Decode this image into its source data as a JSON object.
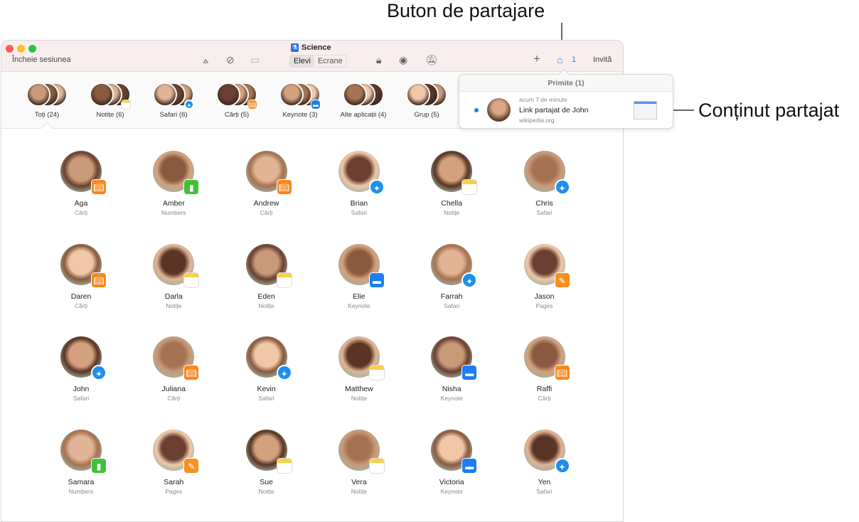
{
  "callouts": {
    "share_button": "Buton de partajare",
    "shared_content": "Conținut partajat"
  },
  "window": {
    "title": "Science",
    "end_session": "Încheie sesiunea",
    "segments": [
      "Elevi",
      "Ecrane"
    ],
    "selected_segment": "Elevi",
    "inbox_count": "1",
    "invite": "Invită",
    "toolbar_icons": [
      "app-store-icon",
      "safari-compass-icon",
      "airplay-icon",
      "lock-icon",
      "hide-eye-icon",
      "mute-bell-icon",
      "plus-icon",
      "inbox-tray-icon"
    ]
  },
  "groups": [
    {
      "label": "Toți (24)"
    },
    {
      "label": "Notițe (6)",
      "app": "notes"
    },
    {
      "label": "Safari (6)",
      "app": "safari"
    },
    {
      "label": "Cărți (5)",
      "app": "books"
    },
    {
      "label": "Keynote (3)",
      "app": "keynote"
    },
    {
      "label": "Alte aplicații (4)"
    },
    {
      "label": "Grup (5)"
    }
  ],
  "selected_group": "Toți (24)",
  "inbox": {
    "header": "Primite (1)",
    "item": {
      "time": "acum 7 de minute",
      "title": "Link partajat de John",
      "source": "wikipedia.org",
      "unread": true
    }
  },
  "students": [
    {
      "name": "Aga",
      "app": "Cărți",
      "badge": "books"
    },
    {
      "name": "Amber",
      "app": "Numbers",
      "badge": "numbers"
    },
    {
      "name": "Andrew",
      "app": "Cărți",
      "badge": "books"
    },
    {
      "name": "Brian",
      "app": "Safari",
      "badge": "safari"
    },
    {
      "name": "Chella",
      "app": "Notițe",
      "badge": "notes"
    },
    {
      "name": "Chris",
      "app": "Safari",
      "badge": "safari"
    },
    {
      "name": "Daren",
      "app": "Cărți",
      "badge": "books"
    },
    {
      "name": "Darla",
      "app": "Notițe",
      "badge": "notes"
    },
    {
      "name": "Eden",
      "app": "Notițe",
      "badge": "notes"
    },
    {
      "name": "Elie",
      "app": "Keynote",
      "badge": "keynote"
    },
    {
      "name": "Farrah",
      "app": "Safari",
      "badge": "safari"
    },
    {
      "name": "Jason",
      "app": "Pages",
      "badge": "pages"
    },
    {
      "name": "John",
      "app": "Safari",
      "badge": "safari"
    },
    {
      "name": "Juliana",
      "app": "Cărți",
      "badge": "books"
    },
    {
      "name": "Kevin",
      "app": "Safari",
      "badge": "safari"
    },
    {
      "name": "Matthew",
      "app": "Notițe",
      "badge": "notes"
    },
    {
      "name": "Nisha",
      "app": "Keynote",
      "badge": "keynote"
    },
    {
      "name": "Raffi",
      "app": "Cărți",
      "badge": "books"
    },
    {
      "name": "Samara",
      "app": "Numbers",
      "badge": "numbers"
    },
    {
      "name": "Sarah",
      "app": "Pages",
      "badge": "pages"
    },
    {
      "name": "Sue",
      "app": "Notițe",
      "badge": "notes"
    },
    {
      "name": "Vera",
      "app": "Notițe",
      "badge": "notes"
    },
    {
      "name": "Victoria",
      "app": "Keynote",
      "badge": "keynote"
    },
    {
      "name": "Yen",
      "app": "Safari",
      "badge": "safari"
    }
  ]
}
